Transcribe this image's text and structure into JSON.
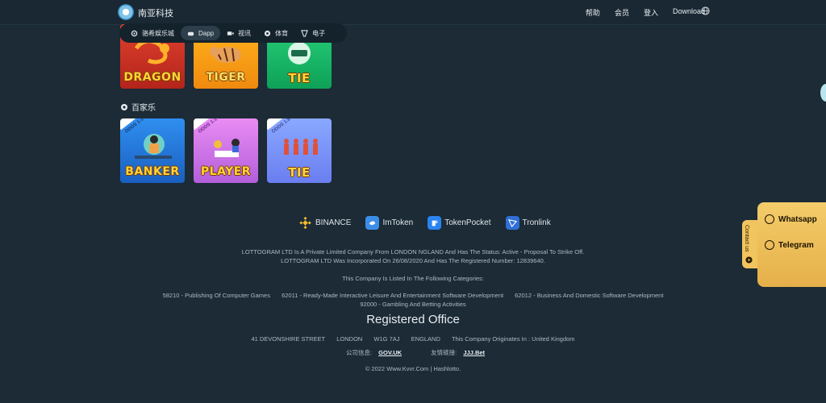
{
  "header": {
    "brand": "南亚科技",
    "nav": [
      "帮助",
      "会员",
      "登入",
      "Download"
    ]
  },
  "categories": [
    {
      "label": "骆希娱乐城",
      "icon": "gear-icon",
      "active": false
    },
    {
      "label": "Dapp",
      "icon": "gamepad-icon",
      "active": true
    },
    {
      "label": "视讯",
      "icon": "video-icon",
      "active": false
    },
    {
      "label": "体育",
      "icon": "ball-icon",
      "active": false
    },
    {
      "label": "电子",
      "icon": "slot-icon",
      "active": false
    }
  ],
  "games_row1": [
    "DRAGON",
    "TIGER",
    "TIE"
  ],
  "section_title": "百家乐",
  "games_row2": [
    {
      "word": "BANKER",
      "odds": "ODDS 1:1"
    },
    {
      "word": "PLAYER",
      "odds": "ODDS 1:1"
    },
    {
      "word": "TIE",
      "odds": "ODDS 1:8"
    }
  ],
  "wallets": [
    {
      "name": "BINANCE",
      "color": "#f3ba2f"
    },
    {
      "name": "ImToken",
      "color": "#3b8ee8"
    },
    {
      "name": "TokenPocket",
      "color": "#2a84f0"
    },
    {
      "name": "Tronlink",
      "color": "#2f6fd6"
    }
  ],
  "footer": {
    "line1": "LOTTOGRAM LTD Is A Private Limited Company From LONDON NGLAND And Has The Status: Active - Proposal To Strike Off.",
    "line2": "LOTTOGRAM LTD Was Incorporated On 26/08/2020 And Has The Registered Number: 12839640.",
    "listed": "This Company Is Listed In The Following Categories:",
    "cat_a": "58210 - Publishing Of Computer Games",
    "cat_b": "62011 - Ready-Made Interactive Leisure And Entertainment Software Development",
    "cat_c": "62012 - Business And Domestic Software Development",
    "cat_d": "92000 - Gambling And Betting Activities",
    "reg_title": "Registered Office",
    "addr": [
      "41 DEVONSHIRE STREET",
      "LONDON",
      "W1G 7AJ",
      "ENGLAND",
      "This Company Originates In : United Kingdom"
    ],
    "info_label": "公司信息:",
    "info_link": "GOV.UK",
    "friend_label": "友情链接:",
    "friend_link": "JJJ.Bet",
    "copyright": "© 2022 Www.Kvvr.Com | Hashlotto."
  },
  "contact": {
    "tab": "Contact us",
    "whatsapp": "Whatsapp",
    "telegram": "Telegram"
  }
}
